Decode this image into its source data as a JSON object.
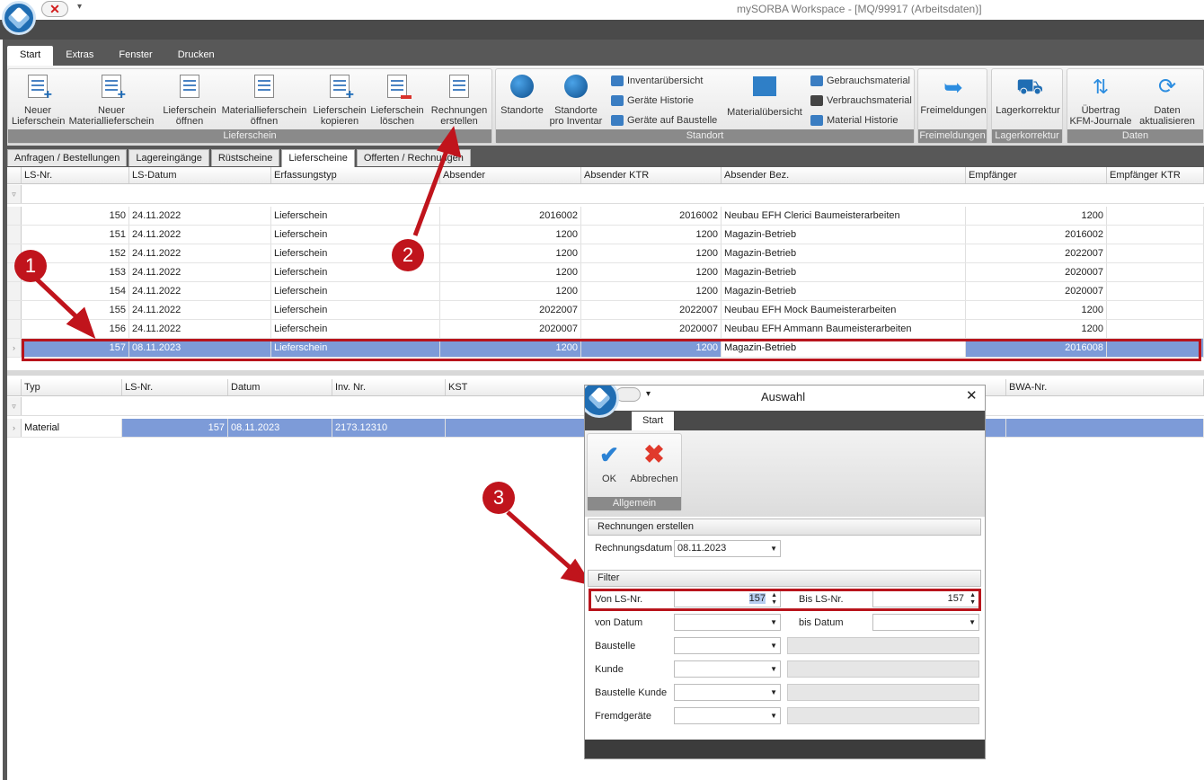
{
  "window": {
    "title": "mySORBA Workspace - [MQ/99917 (Arbeitsdaten)]",
    "qat_close": "✕",
    "qat_more": "▾"
  },
  "ribbon": {
    "tabs": [
      "Start",
      "Extras",
      "Fenster",
      "Drucken"
    ],
    "groups": {
      "lieferschein": "Lieferschein",
      "standort": "Standort",
      "freimeldungen": "Freimeldungen",
      "lagerkorrektur": "Lagerkorrektur",
      "daten": "Daten"
    },
    "buttons": {
      "neuer_ls": [
        "Neuer",
        "Lieferschein"
      ],
      "neuer_mat_ls": [
        "Neuer",
        "Materiallieferschein"
      ],
      "ls_oeffnen": [
        "Lieferschein",
        "öffnen"
      ],
      "mat_ls_oeffnen": [
        "Materiallieferschein",
        "öffnen"
      ],
      "ls_kopieren": [
        "Lieferschein",
        "kopieren"
      ],
      "ls_loeschen": [
        "Lieferschein",
        "löschen"
      ],
      "rechnungen_erstellen": [
        "Rechnungen",
        "erstellen"
      ],
      "standorte": [
        "Standorte",
        ""
      ],
      "standorte_inventar": [
        "Standorte",
        "pro Inventar"
      ],
      "inventaruebersicht": "Inventarübersicht",
      "geraete_historie": "Geräte Historie",
      "geraete_baustelle": "Geräte auf Baustelle",
      "materialuebersicht": "Materialübersicht",
      "gebrauchsmaterial": "Gebrauchsmaterial",
      "verbrauchsmaterial": "Verbrauchsmaterial",
      "material_historie": "Material Historie",
      "freimeldungen": "Freimeldungen",
      "lagerkorrektur": "Lagerkorrektur",
      "uebertrag": [
        "Übertrag",
        "KFM-Journale"
      ],
      "daten_aktualisieren": [
        "Daten",
        "aktualisieren"
      ]
    }
  },
  "doctabs": [
    "Anfragen / Bestellungen",
    "Lagereingänge",
    "Rüstscheine",
    "Lieferscheine",
    "Offerten / Rechnungen"
  ],
  "main_grid": {
    "columns": [
      "LS-Nr.",
      "LS-Datum",
      "Erfassungstyp",
      "Absender",
      "Absender KTR",
      "Absender Bez.",
      "Empfänger",
      "Empfänger KTR"
    ],
    "rows": [
      [
        "150",
        "24.11.2022",
        "Lieferschein",
        "2016002",
        "2016002",
        "Neubau EFH Clerici Baumeisterarbeiten",
        "1200",
        ""
      ],
      [
        "151",
        "24.11.2022",
        "Lieferschein",
        "1200",
        "1200",
        "Magazin-Betrieb",
        "2016002",
        ""
      ],
      [
        "152",
        "24.11.2022",
        "Lieferschein",
        "1200",
        "1200",
        "Magazin-Betrieb",
        "2022007",
        ""
      ],
      [
        "153",
        "24.11.2022",
        "Lieferschein",
        "1200",
        "1200",
        "Magazin-Betrieb",
        "2020007",
        ""
      ],
      [
        "154",
        "24.11.2022",
        "Lieferschein",
        "1200",
        "1200",
        "Magazin-Betrieb",
        "2020007",
        ""
      ],
      [
        "155",
        "24.11.2022",
        "Lieferschein",
        "2022007",
        "2022007",
        "Neubau EFH Mock Baumeisterarbeiten",
        "1200",
        ""
      ],
      [
        "156",
        "24.11.2022",
        "Lieferschein",
        "2020007",
        "2020007",
        "Neubau EFH Ammann Baumeisterarbeiten",
        "1200",
        ""
      ],
      [
        "157",
        "08.11.2023",
        "Lieferschein",
        "1200",
        "1200",
        "Magazin-Betrieb",
        "2016008",
        ""
      ]
    ]
  },
  "detail_grid": {
    "columns": [
      "Typ",
      "LS-Nr.",
      "Datum",
      "Inv. Nr.",
      "KST",
      "BWA-Nr."
    ],
    "row": [
      "Material",
      "157",
      "08.11.2023",
      "2173.12310",
      ""
    ]
  },
  "annotations": [
    "1",
    "2",
    "3"
  ],
  "dialog": {
    "title": "Auswahl",
    "close": "✕",
    "tab": "Start",
    "ok": "OK",
    "cancel": "Abbrechen",
    "group": "Allgemein",
    "section_invoices": "Rechnungen erstellen",
    "invoice_date_label": "Rechnungsdatum",
    "invoice_date": "08.11.2023",
    "section_filter": "Filter",
    "from_ls_label": "Von LS-Nr.",
    "from_ls": "157",
    "to_ls_label": "Bis LS-Nr.",
    "to_ls": "157",
    "from_date_label": "von Datum",
    "to_date_label": "bis Datum",
    "site_label": "Baustelle",
    "customer_label": "Kunde",
    "customer_site_label": "Baustelle Kunde",
    "foreign_label": "Fremdgeräte"
  },
  "colors": {
    "selection": "#7d9bd8",
    "annotation": "#c0141c",
    "accent": "#1f6db3"
  }
}
